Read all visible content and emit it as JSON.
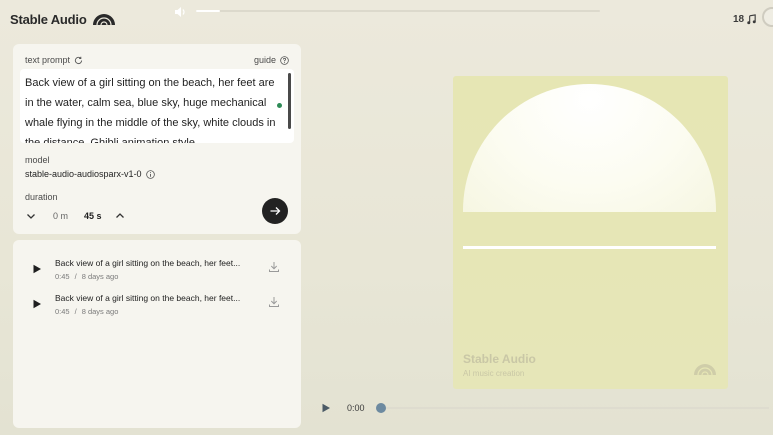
{
  "app": {
    "brand": "Stable Audio",
    "credits": "18"
  },
  "prompt": {
    "header_label": "text prompt",
    "guide_label": "guide",
    "text": "Back view of a girl sitting on the beach, her feet are in the water, calm sea, blue sky, huge mechanical whale flying in the middle of the sky, white clouds in the distance, Ghibli animation style"
  },
  "model": {
    "label": "model",
    "value": "stable-audio-audiosparx-v1-0"
  },
  "duration": {
    "label": "duration",
    "minutes": "0 m",
    "seconds": "45 s"
  },
  "history": [
    {
      "title": "Back view of a girl sitting on the beach, her feet...",
      "length": "0:45",
      "separator": "/",
      "age": "8 days ago"
    },
    {
      "title": "Back view of a girl sitting on the beach, her feet...",
      "length": "0:45",
      "separator": "/",
      "age": "8 days ago"
    }
  ],
  "cover": {
    "title": "Stable Audio",
    "subtitle": "AI music creation"
  },
  "player": {
    "time": "0:00",
    "progress": 0.0
  },
  "volume": {
    "level": 0.06
  },
  "icons": {
    "brand": "stable-audio-logo-icon",
    "volume": "speaker-icon",
    "credits": "music-note-icon",
    "refresh": "refresh-icon",
    "help": "question-circle-icon",
    "info": "info-circle-icon",
    "decrease": "chevron-down-icon",
    "increase": "chevron-up-icon",
    "generate": "arrow-right-icon",
    "play": "play-icon",
    "download": "download-icon"
  },
  "colors": {
    "background": "#ece9dc",
    "card": "#f6f5ef",
    "cover": "#e6e6b4",
    "accent_dot": "#2e8b57",
    "button": "#222222",
    "knob": "#6d8aa0"
  }
}
